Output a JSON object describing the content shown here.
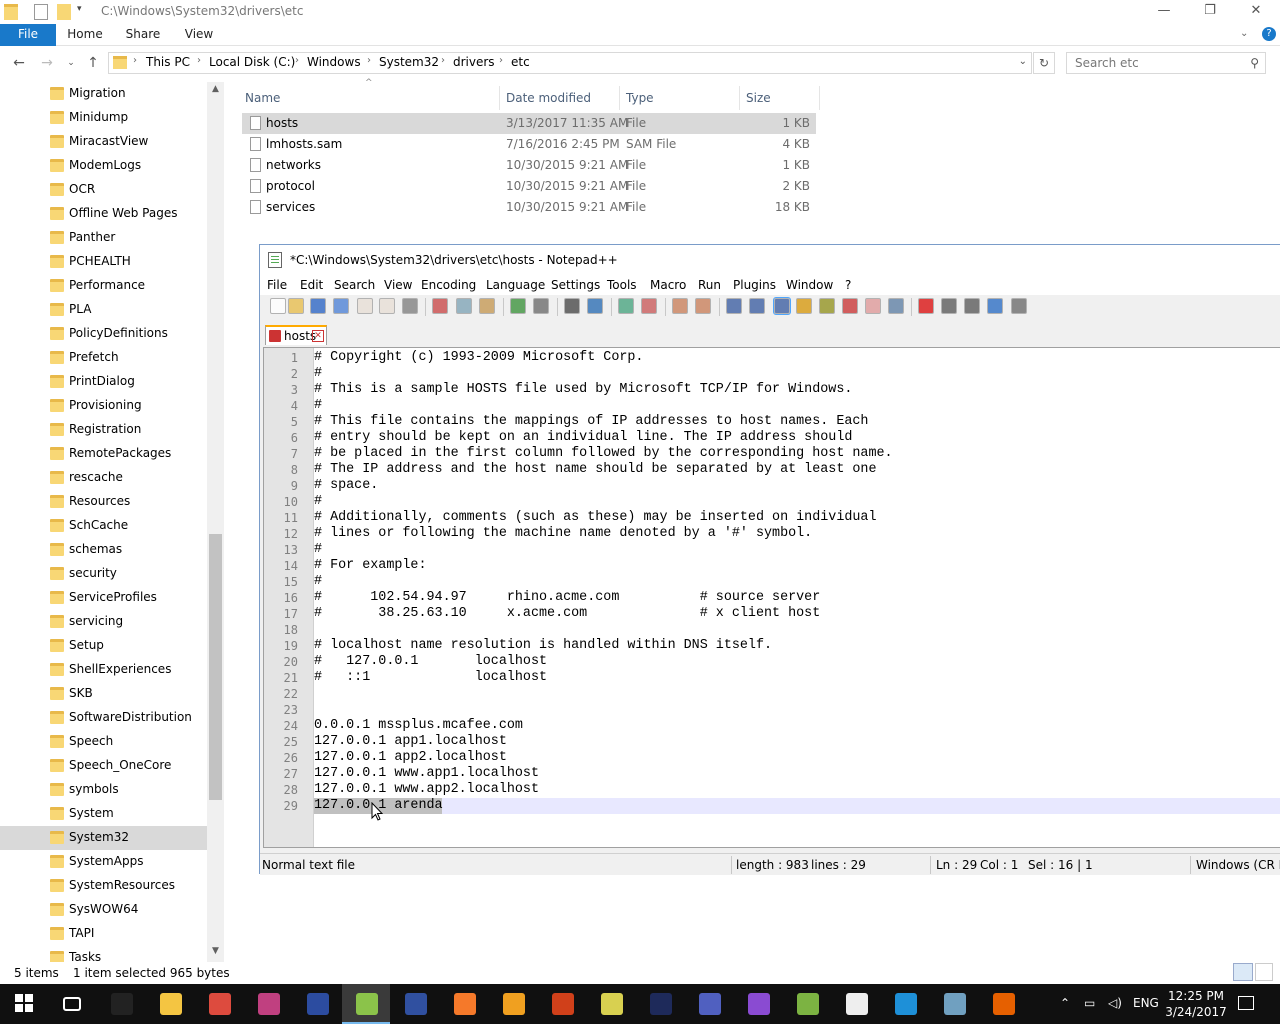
{
  "explorer": {
    "title_path": "C:\\Windows\\System32\\drivers\\etc",
    "ribbon_tabs": [
      "File",
      "Home",
      "Share",
      "View"
    ],
    "breadcrumbs": [
      "This PC",
      "Local Disk (C:)",
      "Windows",
      "System32",
      "drivers",
      "etc"
    ],
    "search_placeholder": "Search etc",
    "nav_items": [
      "Migration",
      "Minidump",
      "MiracastView",
      "ModemLogs",
      "OCR",
      "Offline Web Pages",
      "Panther",
      "PCHEALTH",
      "Performance",
      "PLA",
      "PolicyDefinitions",
      "Prefetch",
      "PrintDialog",
      "Provisioning",
      "Registration",
      "RemotePackages",
      "rescache",
      "Resources",
      "SchCache",
      "schemas",
      "security",
      "ServiceProfiles",
      "servicing",
      "Setup",
      "ShellExperiences",
      "SKB",
      "SoftwareDistribution",
      "Speech",
      "Speech_OneCore",
      "symbols",
      "System",
      "System32",
      "SystemApps",
      "SystemResources",
      "SysWOW64",
      "TAPI",
      "Tasks"
    ],
    "nav_selected": "System32",
    "columns": {
      "name": "Name",
      "date": "Date modified",
      "type": "Type",
      "size": "Size"
    },
    "files": [
      {
        "name": "hosts",
        "date": "3/13/2017 11:35 AM",
        "type": "File",
        "size": "1 KB",
        "selected": true
      },
      {
        "name": "lmhosts.sam",
        "date": "7/16/2016 2:45 PM",
        "type": "SAM File",
        "size": "4 KB"
      },
      {
        "name": "networks",
        "date": "10/30/2015 9:21 AM",
        "type": "File",
        "size": "1 KB"
      },
      {
        "name": "protocol",
        "date": "10/30/2015 9:21 AM",
        "type": "File",
        "size": "2 KB"
      },
      {
        "name": "services",
        "date": "10/30/2015 9:21 AM",
        "type": "File",
        "size": "18 KB"
      }
    ],
    "status_items": "5 items",
    "status_selection": "1 item selected  965 bytes"
  },
  "notepad": {
    "title": "*C:\\Windows\\System32\\drivers\\etc\\hosts - Notepad++",
    "menu": [
      "File",
      "Edit",
      "Search",
      "View",
      "Encoding",
      "Language",
      "Settings",
      "Tools",
      "Macro",
      "Run",
      "Plugins",
      "Window",
      "?"
    ],
    "tab_name": "hosts",
    "lines": [
      "# Copyright (c) 1993-2009 Microsoft Corp.",
      "#",
      "# This is a sample HOSTS file used by Microsoft TCP/IP for Windows.",
      "#",
      "# This file contains the mappings of IP addresses to host names. Each",
      "# entry should be kept on an individual line. The IP address should",
      "# be placed in the first column followed by the corresponding host name.",
      "# The IP address and the host name should be separated by at least one",
      "# space.",
      "#",
      "# Additionally, comments (such as these) may be inserted on individual",
      "# lines or following the machine name denoted by a '#' symbol.",
      "#",
      "# For example:",
      "#",
      "#      102.54.94.97     rhino.acme.com          # source server",
      "#       38.25.63.10     x.acme.com              # x client host",
      "",
      "# localhost name resolution is handled within DNS itself.",
      "#   127.0.0.1       localhost",
      "#   ::1             localhost",
      "",
      "",
      "0.0.0.1 mssplus.mcafee.com",
      "127.0.0.1 app1.localhost",
      "127.0.0.1 app2.localhost",
      "127.0.0.1 www.app1.localhost",
      "127.0.0.1 www.app2.localhost",
      "127.0.0.1 arenda"
    ],
    "current_line": 29,
    "status": {
      "file_type": "Normal text file",
      "length": "length : 983",
      "lines": "lines : 29",
      "ln": "Ln : 29",
      "col": "Col : 1",
      "sel": "Sel : 16 | 1",
      "eol": "Windows (CR LF)"
    }
  },
  "taskbar": {
    "time": "12:25 PM",
    "date": "3/24/2017",
    "lang": "ENG"
  },
  "colors": {
    "accent": "#1979ca",
    "selection": "#d9d9d9",
    "taskbar": "#101010"
  }
}
